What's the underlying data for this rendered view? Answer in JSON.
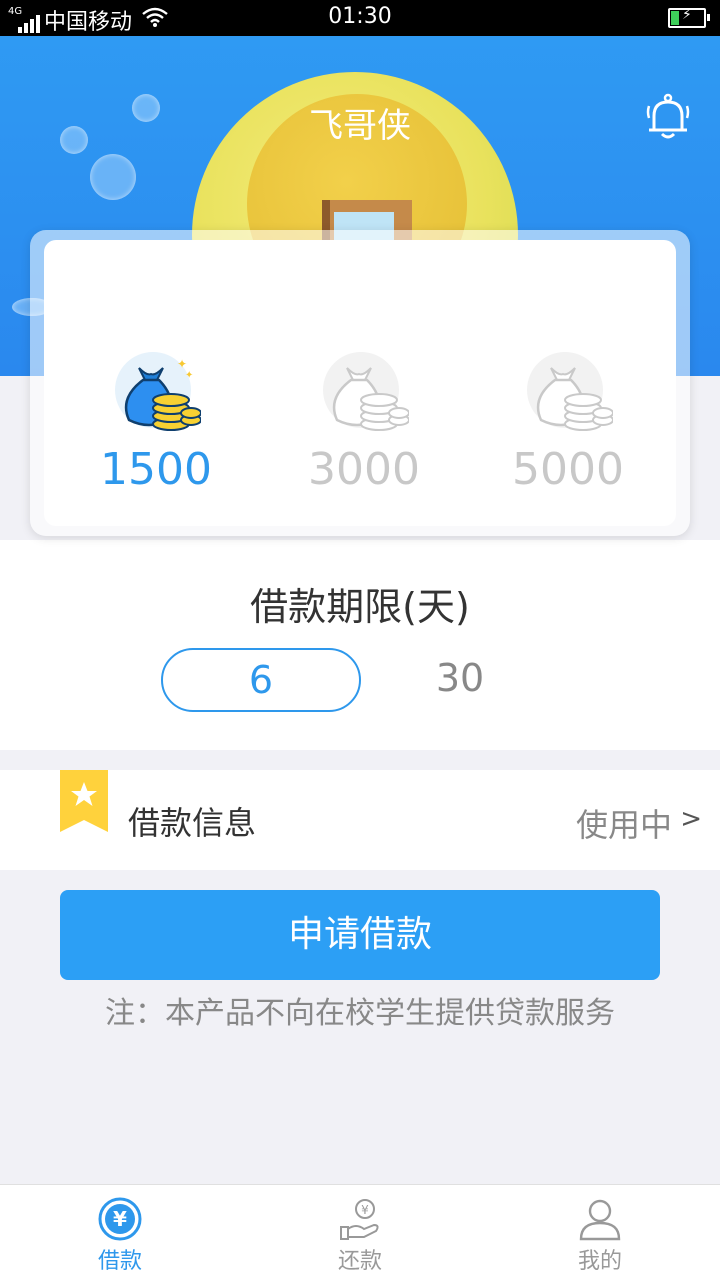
{
  "status_bar": {
    "network": "4G",
    "carrier": "中国移动",
    "time": "01:30"
  },
  "header": {
    "app_title": "飞哥侠",
    "icons": {
      "bell": "bell-icon"
    }
  },
  "amounts": {
    "items": [
      {
        "label": "1500",
        "selected": true
      },
      {
        "label": "3000",
        "selected": false
      },
      {
        "label": "5000",
        "selected": false
      }
    ]
  },
  "period": {
    "title": "借款期限(天)",
    "options": [
      {
        "label": "6",
        "selected": true
      },
      {
        "label": "30",
        "selected": false
      }
    ]
  },
  "loan_info": {
    "label": "借款信息",
    "status": "使用中",
    "chevron": ">"
  },
  "apply_button": {
    "label": "申请借款"
  },
  "note": "注：本产品不向在校学生提供贷款服务",
  "tabs": [
    {
      "label": "借款",
      "icon": "yuan-circle-icon",
      "active": true
    },
    {
      "label": "还款",
      "icon": "repay-hand-icon",
      "active": false
    },
    {
      "label": "我的",
      "icon": "user-icon",
      "active": false
    }
  ],
  "colors": {
    "brand_blue": "#2e98ec",
    "button_blue": "#2c9ff5",
    "ribbon_yellow": "#ffd23c"
  }
}
